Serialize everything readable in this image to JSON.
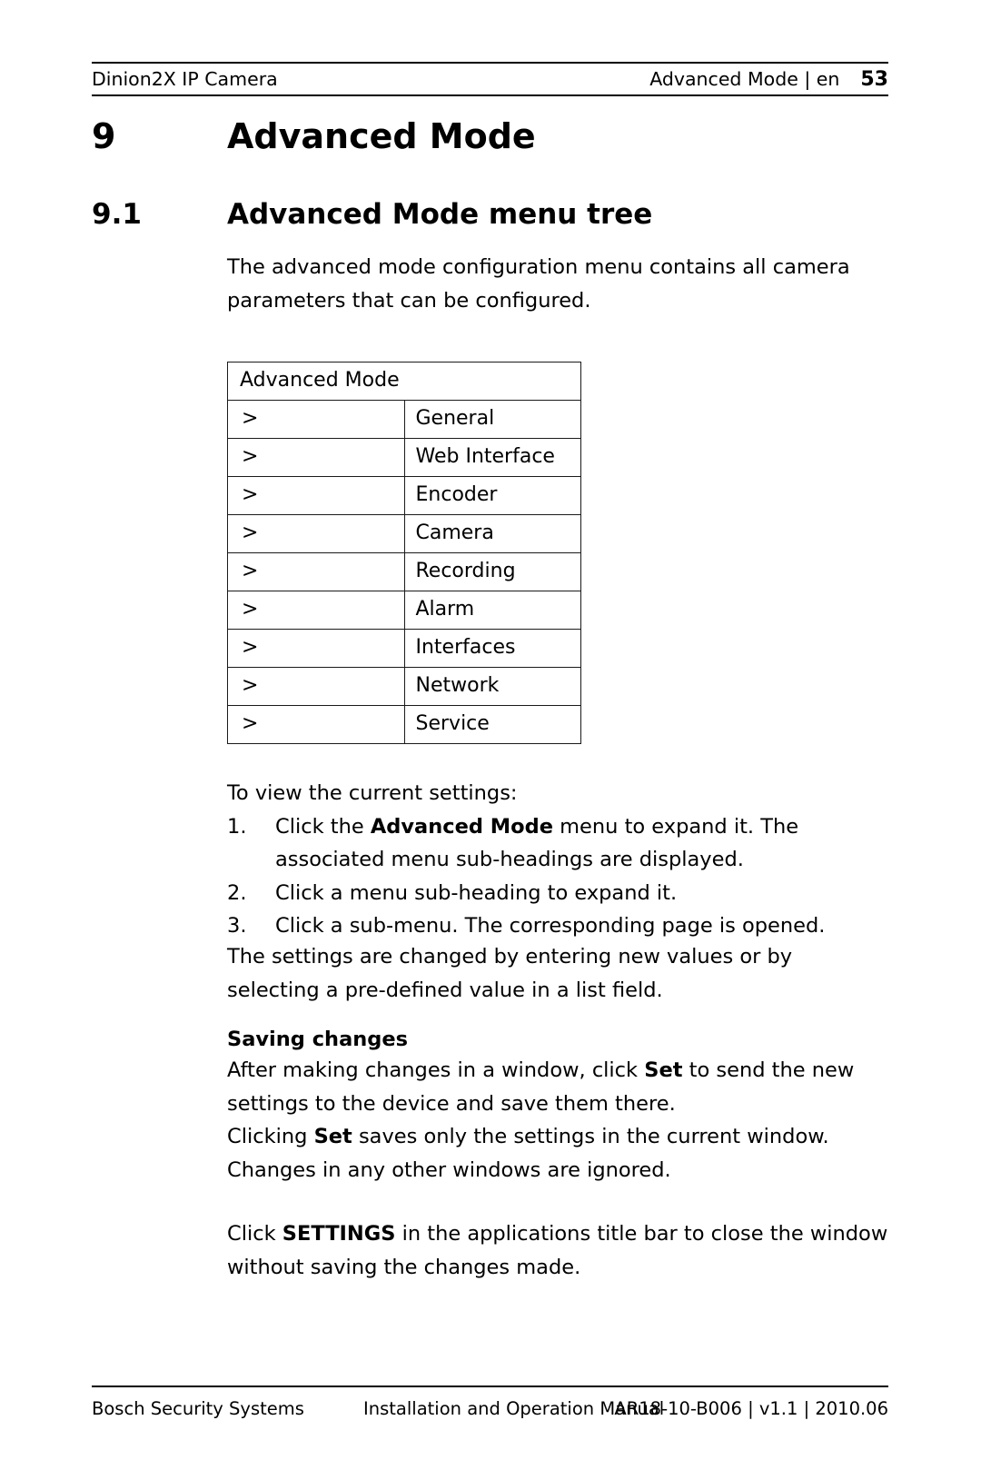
{
  "header": {
    "left": "Dinion2X IP Camera",
    "section": "Advanced Mode | en",
    "page_number": "53"
  },
  "headings": {
    "chapter_number": "9",
    "chapter_title": "Advanced Mode",
    "section_number": "9.1",
    "section_title": "Advanced Mode menu tree"
  },
  "intro": {
    "paragraph": "The advanced mode configuration menu contains all camera parameters that can be configured."
  },
  "menu_tree": {
    "root_label": "Advanced Mode",
    "arrow": ">",
    "items": [
      "General",
      "Web Interface",
      "Encoder",
      "Camera",
      "Recording",
      "Alarm",
      "Interfaces",
      "Network",
      "Service"
    ]
  },
  "procedure": {
    "lead_in": "To view the current settings:",
    "steps": [
      {
        "marker": "1.",
        "before": "Click the ",
        "bold": "Advanced Mode",
        "after": " menu to expand it. The associated menu sub-headings are displayed."
      },
      {
        "marker": "2.",
        "before": "Click a menu sub-heading to expand it.",
        "bold": "",
        "after": ""
      },
      {
        "marker": "3.",
        "before": "Click a sub-menu. The corresponding page is opened.",
        "bold": "",
        "after": ""
      }
    ],
    "after_steps": "The settings are changed by entering new values or by selecting a pre-defined value in a list field."
  },
  "saving_changes": {
    "heading": "Saving changes",
    "line1_before": "After making changes in a window, click ",
    "line1_bold": "Set",
    "line1_after": " to send the new settings to the device and save them there.",
    "line2_before": "Clicking ",
    "line2_bold": "Set",
    "line2_after": " saves only the settings in the current window. Changes in any other windows are ignored.",
    "closing_before": "Click ",
    "closing_bold": "SETTINGS",
    "closing_after": " in the applications title bar to close the window without saving the changes made."
  },
  "footer": {
    "left": "Bosch Security Systems",
    "center": "Installation and Operation Manual",
    "right": "AR18-10-B006 | v1.1 | 2010.06"
  }
}
